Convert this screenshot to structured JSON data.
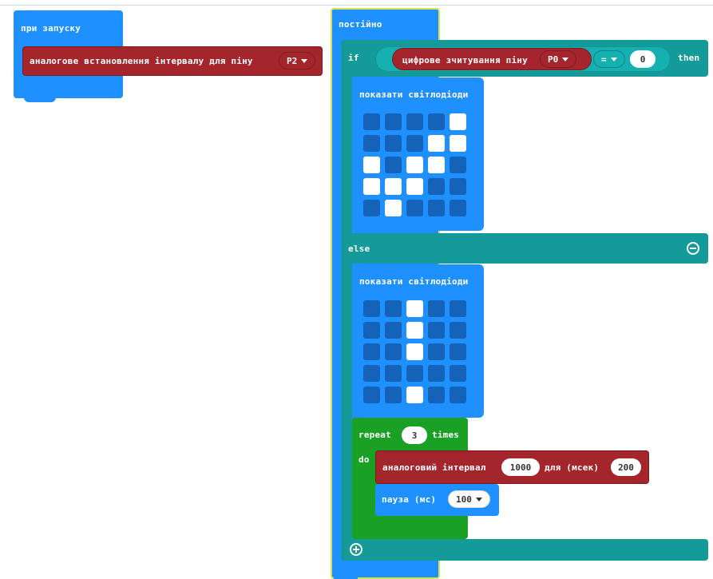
{
  "on_start": {
    "label": "при запуску",
    "block_label": "аналогове встановлення інтервалу для піну",
    "pin": "P2"
  },
  "forever": {
    "label": "постійно",
    "if_label": "if",
    "then_label": "then",
    "else_label": "else",
    "condition": {
      "label": "цифрове зчитування піну",
      "pin": "P0",
      "operator": "=",
      "value": "0"
    },
    "if_leds": {
      "label": "показати світлодіоди",
      "grid": [
        [
          0,
          0,
          0,
          0,
          1
        ],
        [
          0,
          0,
          0,
          1,
          1
        ],
        [
          1,
          0,
          1,
          1,
          0
        ],
        [
          1,
          1,
          1,
          0,
          0
        ],
        [
          0,
          1,
          0,
          0,
          0
        ]
      ]
    },
    "else_leds": {
      "label": "показати світлодіоди",
      "grid": [
        [
          0,
          0,
          1,
          0,
          0
        ],
        [
          0,
          0,
          1,
          0,
          0
        ],
        [
          0,
          0,
          1,
          0,
          0
        ],
        [
          0,
          0,
          0,
          0,
          0
        ],
        [
          0,
          0,
          1,
          0,
          0
        ]
      ]
    },
    "repeat": {
      "label": "repeat",
      "count": "3",
      "times_label": "times",
      "do_label": "do",
      "analog_label": "аналоговий інтервал",
      "analog_value": "1000",
      "for_label": "для (мсек)",
      "for_value": "200",
      "pause_label": "пауза (мс)",
      "pause_value": "100"
    }
  },
  "icons": {
    "minus": "minus-icon",
    "plus": "plus-icon",
    "dropdown": "caret-down-icon"
  },
  "colors": {
    "basic": "#1e90ff",
    "logic": "#159a9a",
    "pins": "#a4262c",
    "loops": "#1aa024",
    "forever_border": "#d8e24c"
  }
}
